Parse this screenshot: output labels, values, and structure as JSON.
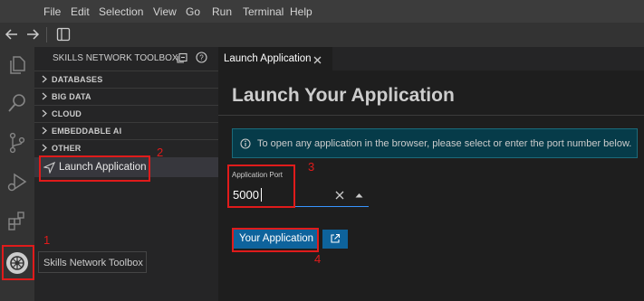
{
  "menu": [
    "File",
    "Edit",
    "Selection",
    "View",
    "Go",
    "Run",
    "Terminal",
    "Help"
  ],
  "sidebar": {
    "title": "SKILLS NETWORK TOOLBOX",
    "sections": [
      "DATABASES",
      "BIG DATA",
      "CLOUD",
      "EMBEDDABLE AI",
      "OTHER"
    ],
    "launch_item": "Launch Application"
  },
  "tooltip": "Skills Network Toolbox",
  "tab": {
    "label": "Launch Application"
  },
  "editor": {
    "heading": "Launch Your Application",
    "info": "To open any application in the browser, please select or enter the port number below.",
    "port_label": "Application Port",
    "port_value": "5000",
    "launch_button": "Your Application"
  },
  "callouts": [
    "1",
    "2",
    "3",
    "4"
  ]
}
